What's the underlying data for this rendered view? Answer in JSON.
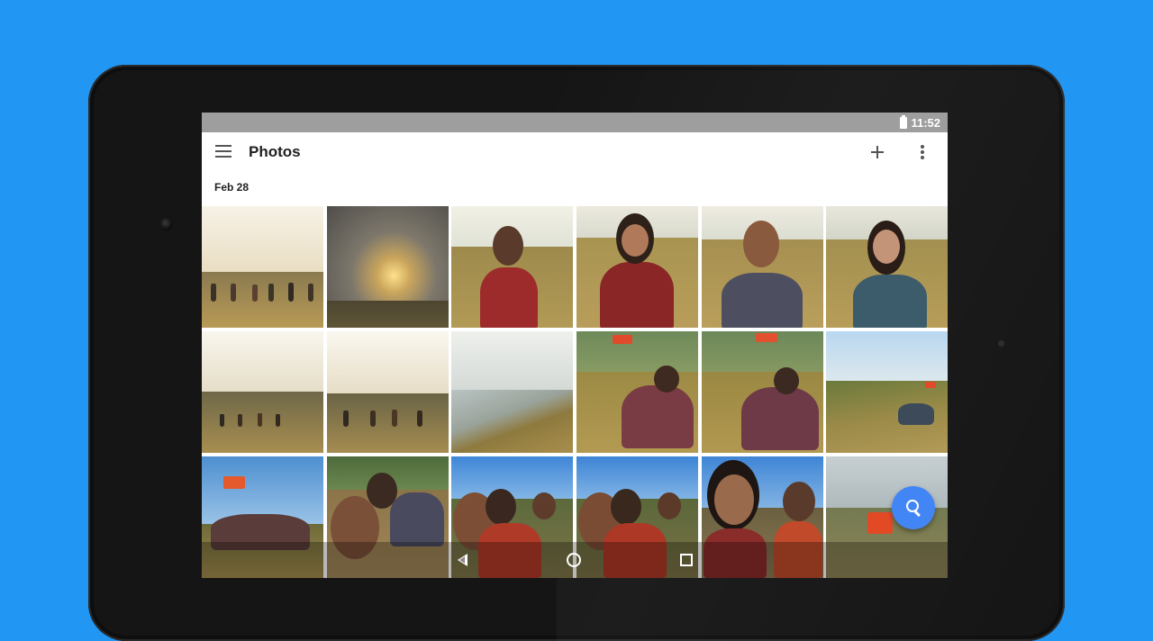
{
  "status_bar": {
    "time": "11:52"
  },
  "app_bar": {
    "title": "Photos"
  },
  "section": {
    "date": "Feb 28"
  },
  "icons": {
    "menu": "hamburger-menu-icon",
    "add": "plus-icon",
    "overflow": "more-vert-icon",
    "search": "search-icon",
    "back": "back-triangle-icon",
    "home": "home-circle-icon",
    "recents": "recents-square-icon"
  },
  "colors": {
    "background": "#2196F3",
    "fab": "#4285F4",
    "status_bar": "#9e9e9e"
  }
}
